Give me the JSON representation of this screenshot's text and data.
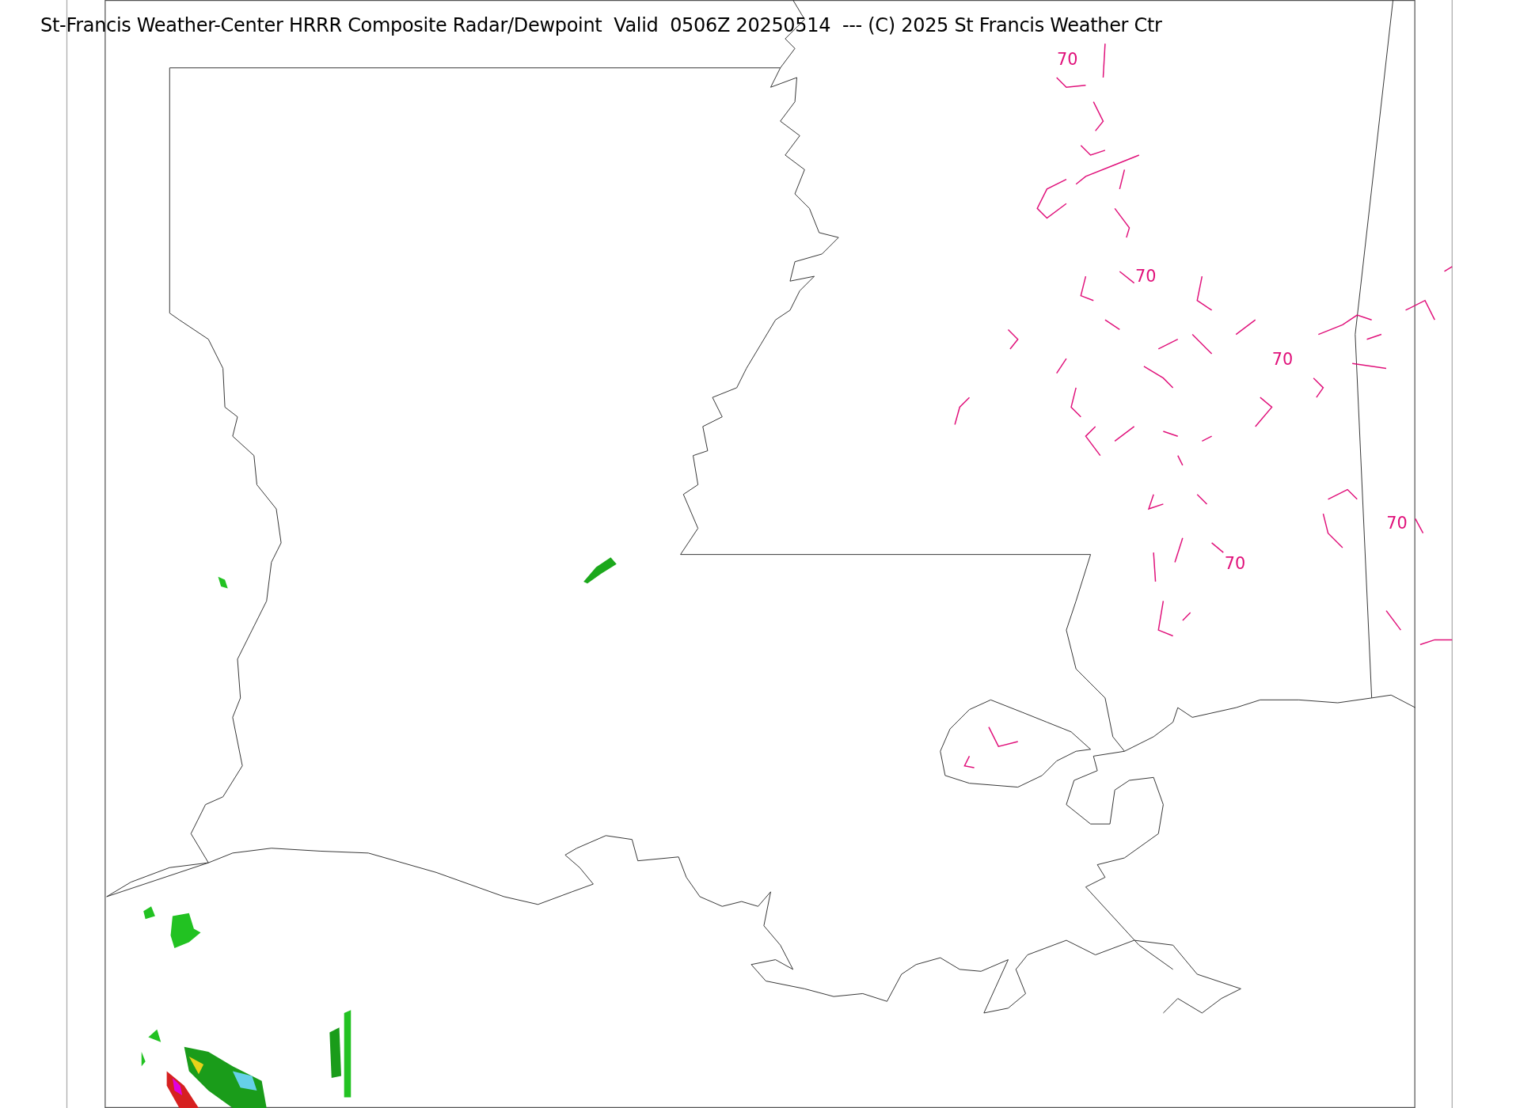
{
  "title": "St-Francis Weather-Center HRRR Composite Radar/Dewpoint  Valid  0506Z 20250514  --- (C) 2025 St Francis Weather Ctr",
  "contour_labels": [
    {
      "text": "70"
    },
    {
      "text": "70"
    },
    {
      "text": "70"
    },
    {
      "text": "70"
    },
    {
      "text": "70"
    }
  ]
}
